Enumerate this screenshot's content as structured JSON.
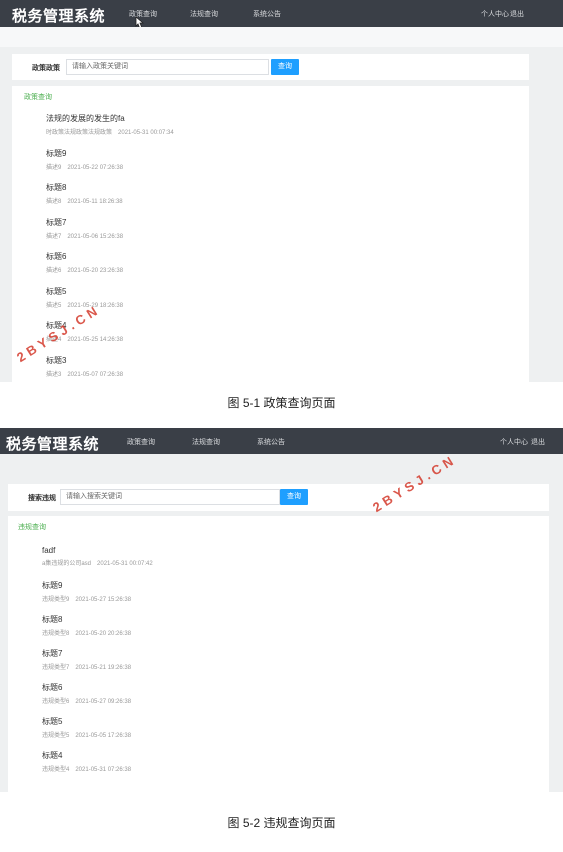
{
  "shot1": {
    "brand": "税务管理系统",
    "nav": [
      "政策查询",
      "法规查询",
      "系统公告"
    ],
    "nav_right": [
      "个人中心",
      "退出"
    ],
    "search_label": "政策政策",
    "search_placeholder": "请输入政策关键词",
    "search_button": "查询",
    "section_title": "政策查询",
    "items": [
      {
        "title": "法规的发展的发生的fa",
        "desc": "时政策法规政策法规政策",
        "time": "2021-05-31 00:07:34"
      },
      {
        "title": "标题9",
        "desc": "描述9",
        "time": "2021-05-22 07:26:38"
      },
      {
        "title": "标题8",
        "desc": "描述8",
        "time": "2021-05-11 18:26:38"
      },
      {
        "title": "标题7",
        "desc": "描述7",
        "time": "2021-05-06 15:26:38"
      },
      {
        "title": "标题6",
        "desc": "描述6",
        "time": "2021-05-20 23:26:38"
      },
      {
        "title": "标题5",
        "desc": "描述5",
        "time": "2021-05-29 18:26:38"
      },
      {
        "title": "标题4",
        "desc": "描述4",
        "time": "2021-05-25 14:26:38"
      },
      {
        "title": "标题3",
        "desc": "描述3",
        "time": "2021-05-07 07:26:38"
      }
    ]
  },
  "caption1": "图 5-1 政策查询页面",
  "shot2": {
    "brand": "税务管理系统",
    "nav": [
      "政策查询",
      "法规查询",
      "系统公告"
    ],
    "nav_right": [
      "个人中心",
      "退出"
    ],
    "search_label": "搜索违规",
    "search_placeholder": "请输入搜索关键词",
    "search_button": "查询",
    "section_title": "违规查询",
    "items": [
      {
        "title": "fadf",
        "desc": "a集违规的公司asd",
        "time": "2021-05-31 00:07:42"
      },
      {
        "title": "标题9",
        "desc": "违规类型9",
        "time": "2021-05-27 15:26:38"
      },
      {
        "title": "标题8",
        "desc": "违规类型8",
        "time": "2021-05-20 20:26:38"
      },
      {
        "title": "标题7",
        "desc": "违规类型7",
        "time": "2021-05-21 19:26:38"
      },
      {
        "title": "标题6",
        "desc": "违规类型6",
        "time": "2021-05-27 09:26:38"
      },
      {
        "title": "标题5",
        "desc": "违规类型5",
        "time": "2021-05-05 17:26:38"
      },
      {
        "title": "标题4",
        "desc": "违规类型4",
        "time": "2021-05-31 07:26:38"
      }
    ]
  },
  "caption2": "图 5-2 违规查询页面",
  "watermark": "2BYSJ.CN",
  "icons": {
    "cursor": "pointer-cursor-icon"
  },
  "colors": {
    "navbar": "#3a3f47",
    "button": "#1e9fff",
    "section": "#4caf50",
    "watermark": "#d43a2c"
  }
}
